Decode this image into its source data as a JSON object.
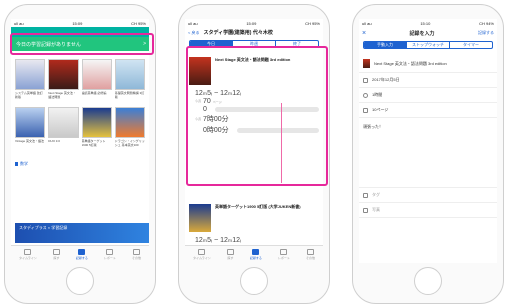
{
  "phone1": {
    "status": {
      "left": "ull au",
      "time": "15:09",
      "right": "CH 95%"
    },
    "banner": {
      "text": "今日の学習記録がありません",
      "arrow": ">"
    },
    "books": [
      {
        "caption": "システム英単語 改訂新版"
      },
      {
        "caption": "Next Stage 英文法・語法問題"
      },
      {
        "caption": "速読英単語 必修編"
      },
      {
        "caption": "基礎英文問題精講 3訂版"
      },
      {
        "caption": "Vintage 英文法・語法"
      },
      {
        "caption": "DUO 3.0"
      },
      {
        "caption": "英単語ターゲット1900 5訂版"
      },
      {
        "caption": "ドラゴン・イングリッシュ 基本英文100"
      }
    ],
    "section": "数学",
    "ad": "スタディプラス × 学習記録",
    "tabs": [
      "タイムライン",
      "探す",
      "記録する",
      "レポート",
      "その他"
    ]
  },
  "phone2": {
    "status": {
      "left": "ull au",
      "time": "15:09",
      "right": "CH 95%"
    },
    "back": "< 戻る",
    "title": "スタディ学園(建築用) 代々木校",
    "segments": [
      "今日",
      "昨週",
      "終了"
    ],
    "rec1": {
      "title": "Next Stage 英文法・語法問題 3rd edition",
      "dates": "12ₘ5ᵢ ~ 12ₘ12ᵢ",
      "pages_label": "今週",
      "pages": "70",
      "pages_unit": "ページ",
      "pages2": "0",
      "time_label": "今週",
      "time": "7時00分",
      "time2": "0時00分"
    },
    "rec2": {
      "title": "英単語ターゲット1900 5訂版 (大学JUKEN新書)",
      "dates": "12ₘ5ᵢ ~ 12ₘ12ᵢ"
    },
    "tabs": [
      "タイムライン",
      "探す",
      "記録する",
      "レポート",
      "その他"
    ]
  },
  "phone3": {
    "status": {
      "left": "ull au",
      "time": "15:10",
      "right": "CH 94%"
    },
    "close": "×",
    "title": "記録を入力",
    "save": "記録する",
    "segments": [
      "手動入力",
      "ストップウォッチ",
      "タイマー"
    ],
    "book": "Next Stage 英文法・語法問題 3rd edition",
    "date": "2017年12月5日",
    "duration": "1時間",
    "pages": "10ページ",
    "memo": "頑張った！",
    "tag": "タグ",
    "photo": "写真"
  },
  "colors": {
    "accent": "#1e62d0",
    "highlight": "#e6289b",
    "banner": "#21c57e"
  }
}
